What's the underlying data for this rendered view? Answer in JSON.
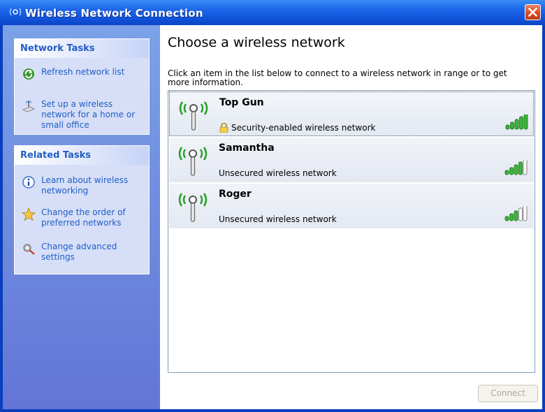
{
  "window": {
    "title": "Wireless Network Connection",
    "icon": "wireless-icon",
    "accent": "#0a3fbd"
  },
  "sidebar": {
    "network_tasks": {
      "header": "Network Tasks",
      "items": [
        {
          "label": "Refresh network list",
          "icon": "refresh-icon"
        },
        {
          "label": "Set up a wireless network for a home or small office",
          "icon": "setup-network-icon"
        }
      ]
    },
    "related_tasks": {
      "header": "Related Tasks",
      "items": [
        {
          "label": "Learn about wireless networking",
          "icon": "info-icon"
        },
        {
          "label": "Change the order of preferred networks",
          "icon": "star-icon"
        },
        {
          "label": "Change advanced settings",
          "icon": "settings-icon"
        }
      ]
    }
  },
  "main": {
    "title": "Choose a wireless network",
    "instructions": "Click an item in the list below to connect to a wireless network in range or to get more information.",
    "networks": [
      {
        "name": "Top Gun",
        "status": "Security-enabled wireless network",
        "secured": true,
        "signal_bars": 5,
        "selected": true
      },
      {
        "name": "Samantha",
        "status": "Unsecured wireless network",
        "secured": false,
        "signal_bars": 4,
        "selected": false
      },
      {
        "name": "Roger",
        "status": "Unsecured wireless network",
        "secured": false,
        "signal_bars": 3,
        "selected": false
      }
    ],
    "connect_label": "Connect"
  }
}
